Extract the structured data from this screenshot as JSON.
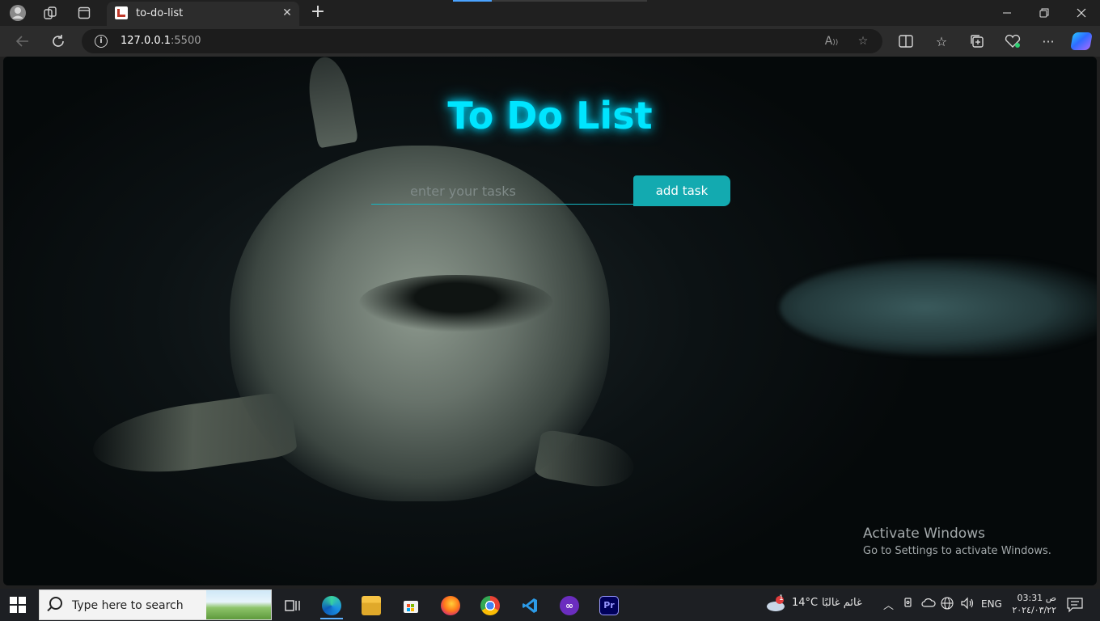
{
  "browser": {
    "tab_title": "to-do-list",
    "url_host": "127.0.0.1",
    "url_port": ":5500"
  },
  "page": {
    "title": "To Do List",
    "input_placeholder": "enter your tasks",
    "add_button_label": "add task"
  },
  "watermark": {
    "heading": "Activate Windows",
    "subtext": "Go to Settings to activate Windows."
  },
  "taskbar": {
    "search_placeholder": "Type here to search",
    "weather_temp": "14°C",
    "weather_desc": "غائم غالبًا",
    "weather_badge": "1",
    "language": "ENG",
    "time": "03:31 ص",
    "date": "٢٠٢٤/٠٣/٢٢"
  },
  "colors": {
    "accent": "#00e5ff",
    "button": "#13aab0"
  }
}
